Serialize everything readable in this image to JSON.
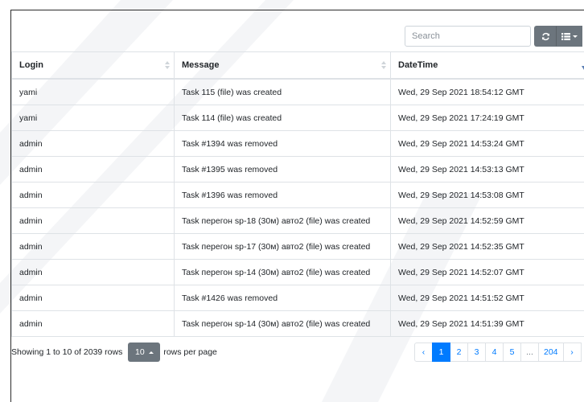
{
  "toolbar": {
    "search_placeholder": "Search",
    "refresh_icon": "refresh-icon",
    "columns_icon": "columns-list-icon"
  },
  "table": {
    "columns": [
      {
        "label": "Login",
        "sort": "none"
      },
      {
        "label": "Message",
        "sort": "none"
      },
      {
        "label": "DateTime",
        "sort": "desc"
      }
    ],
    "rows": [
      {
        "login": "yami",
        "message": "Task 115 (file) was created",
        "datetime": "Wed, 29 Sep 2021 18:54:12 GMT"
      },
      {
        "login": "yami",
        "message": "Task 114 (file) was created",
        "datetime": "Wed, 29 Sep 2021 17:24:19 GMT"
      },
      {
        "login": "admin",
        "message": "Task #1394 was removed",
        "datetime": "Wed, 29 Sep 2021 14:53:24 GMT"
      },
      {
        "login": "admin",
        "message": "Task #1395 was removed",
        "datetime": "Wed, 29 Sep 2021 14:53:13 GMT"
      },
      {
        "login": "admin",
        "message": "Task #1396 was removed",
        "datetime": "Wed, 29 Sep 2021 14:53:08 GMT"
      },
      {
        "login": "admin",
        "message": "Task перегон sp-18 (30м) авто2 (file) was created",
        "datetime": "Wed, 29 Sep 2021 14:52:59 GMT"
      },
      {
        "login": "admin",
        "message": "Task перегон sp-17 (30м) авто2 (file) was created",
        "datetime": "Wed, 29 Sep 2021 14:52:35 GMT"
      },
      {
        "login": "admin",
        "message": "Task перегон sp-14 (30м) авто2 (file) was created",
        "datetime": "Wed, 29 Sep 2021 14:52:07 GMT"
      },
      {
        "login": "admin",
        "message": "Task #1426 was removed",
        "datetime": "Wed, 29 Sep 2021 14:51:52 GMT"
      },
      {
        "login": "admin",
        "message": "Task перегон sp-14 (30м) авто2 (file) was created",
        "datetime": "Wed, 29 Sep 2021 14:51:39 GMT"
      }
    ]
  },
  "footer": {
    "showing_text": "Showing 1 to 10 of 2039 rows",
    "page_size": "10",
    "rows_per_page_label": "rows per page"
  },
  "pagination": {
    "prev": "‹",
    "pages": [
      {
        "label": "1",
        "active": true
      },
      {
        "label": "2",
        "active": false
      },
      {
        "label": "3",
        "active": false
      },
      {
        "label": "4",
        "active": false
      },
      {
        "label": "5",
        "active": false
      }
    ],
    "ellipsis": "...",
    "last_page": "204",
    "next": "›"
  },
  "colors": {
    "primary": "#007bff",
    "secondary": "#6c757d",
    "border": "#dee2e6"
  }
}
